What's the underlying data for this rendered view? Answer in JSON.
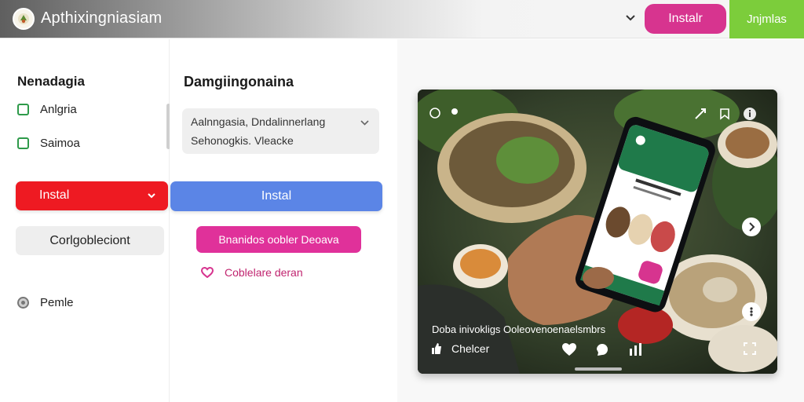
{
  "header": {
    "app_title": "Apthixingniasiam",
    "install_label": "Instalr",
    "green_label": "Jnjmlas"
  },
  "sidebar": {
    "heading": "Nenadagia",
    "checkboxes": [
      {
        "label": "Anlgria",
        "checked": false
      },
      {
        "label": "Saimoa",
        "checked": false
      }
    ],
    "select_label": "Instal",
    "secondary_button": "Corlgobleciont",
    "radio_label": "Pemle"
  },
  "form": {
    "heading": "Damgiingonaina",
    "select_line1": "Aalnngasia, Dndalinnerlang",
    "select_line2": "Sehonogkis. Vleacke",
    "primary_button": "Instal",
    "pink_button": "Bnanidos oobler Deoava",
    "heart_link": "Coblelare deran"
  },
  "media": {
    "caption": "Doba inivokligs Ooleovenoenaelsmbrs",
    "like_label": "Chelcer"
  },
  "colors": {
    "install": "#d7348f",
    "green": "#7ccd3b",
    "red_select": "#ee1a22",
    "blue_button": "#5b85e6",
    "pink_button": "#e0319a",
    "checkbox": "#2e9a4a"
  },
  "icons": [
    "logo-icon",
    "chevron-down-icon",
    "heart-outline-icon",
    "heart-icon",
    "share-icon",
    "more-icon",
    "info-icon",
    "chevron-right-icon"
  ]
}
